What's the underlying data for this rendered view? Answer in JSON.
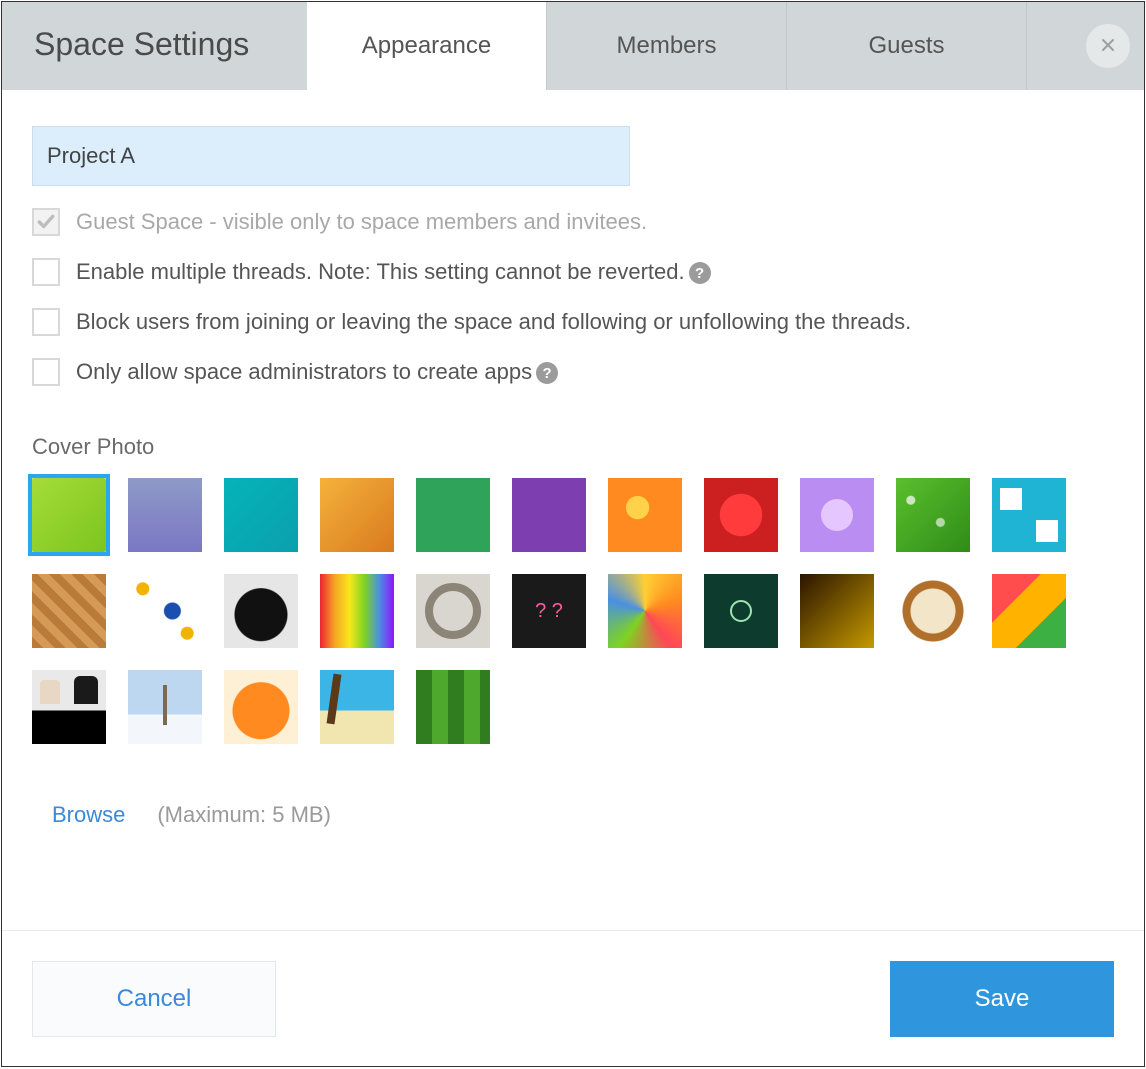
{
  "dialog": {
    "title": "Space Settings",
    "tabs": [
      {
        "label": "Appearance",
        "active": true
      },
      {
        "label": "Members",
        "active": false
      },
      {
        "label": "Guests",
        "active": false
      }
    ],
    "space_name": "Project A",
    "options": {
      "guest_space": {
        "label": "Guest Space - visible only to space members and invitees.",
        "checked": true,
        "disabled": true
      },
      "multi_thread": {
        "label": "Enable multiple threads. Note: This setting cannot be reverted.",
        "checked": false,
        "help": true
      },
      "block_join": {
        "label": "Block users from joining or leaving the space and following or unfollowing the threads.",
        "checked": false
      },
      "admin_apps": {
        "label": "Only allow space administrators to create apps",
        "checked": false,
        "help": true
      }
    },
    "cover": {
      "section_label": "Cover Photo",
      "browse_label": "Browse",
      "limit_label": "(Maximum: 5 MB)",
      "selected_index": 0,
      "thumbnails": [
        "green-curves",
        "purple-gradient",
        "teal-water",
        "orange-texture",
        "green-solid",
        "purple-solid",
        "orange-flower",
        "red-flower",
        "lilac-flower",
        "green-leaf",
        "white-cubes",
        "wood-pattern",
        "blue-mosaic",
        "compass",
        "color-pencils",
        "gear",
        "chalkboard-questions",
        "crayon-faces",
        "lightbulbs",
        "dark-gradient",
        "latte-art",
        "vegetables",
        "dogs",
        "winter-trees",
        "pumpkins",
        "tropical-beach",
        "bamboo"
      ]
    },
    "footer": {
      "cancel": "Cancel",
      "save": "Save"
    }
  }
}
